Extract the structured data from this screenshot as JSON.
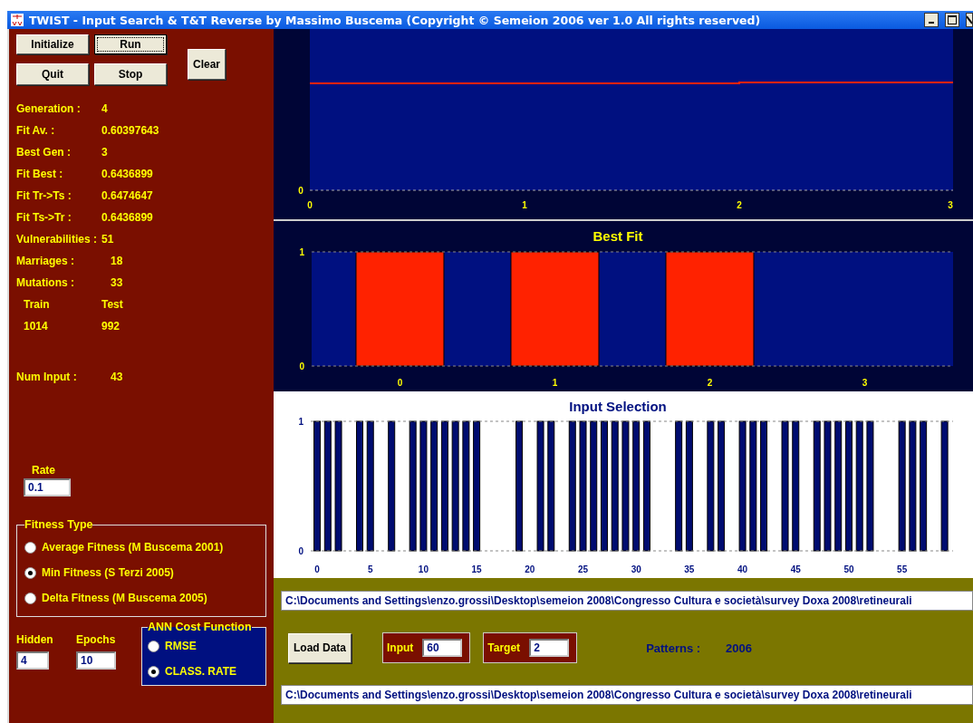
{
  "window": {
    "title": "TWIST - Input Search & T&T Reverse  by Massimo Buscema (Copyright © Semeion 2006 ver 1.0  All rights reserved)"
  },
  "buttons": [
    {
      "label": "Initialize",
      "focused": false
    },
    {
      "label": "Run",
      "focused": true
    },
    {
      "label": "Quit",
      "focused": false
    },
    {
      "label": "Stop",
      "focused": false
    },
    {
      "label": "Clear",
      "focused": false
    }
  ],
  "stats": [
    {
      "label": "Generation :",
      "value": "4"
    },
    {
      "label": "Fit Av. :",
      "value": "0.60397643"
    },
    {
      "label": "Best Gen :",
      "value": "3"
    },
    {
      "label": "Fit Best :",
      "value": "0.6436899"
    },
    {
      "label": "Fit Tr->Ts :",
      "value": "0.6474647"
    },
    {
      "label": "Fit Ts->Tr :",
      "value": "0.6436899"
    },
    {
      "label": "Vulnerabilities :",
      "value": "51"
    },
    {
      "label": "Marriages :",
      "value": "18"
    },
    {
      "label": "Mutations :",
      "value": "33"
    }
  ],
  "split": {
    "train_label": "Train",
    "test_label": "Test",
    "train": "1014",
    "test": "992"
  },
  "num_input": {
    "label": "Num Input  :",
    "value": "43"
  },
  "rate": {
    "label": "Rate",
    "value": "0.1"
  },
  "fitness_type": {
    "title": "Fitness Type",
    "options": [
      {
        "label": "Average Fitness (M Buscema 2001)",
        "selected": false
      },
      {
        "label": "Min Fitness (S Terzi 2005)",
        "selected": true
      },
      {
        "label": "Delta Fitness (M Buscema 2005)",
        "selected": false
      }
    ]
  },
  "hidden": {
    "label": "Hidden",
    "value": "4"
  },
  "epochs": {
    "label": "Epochs",
    "value": "10"
  },
  "ann_cost": {
    "title": "ANN Cost Function",
    "options": [
      {
        "label": "RMSE",
        "selected": false
      },
      {
        "label": "CLASS. RATE",
        "selected": true
      }
    ]
  },
  "fitness_plot": {
    "y_labels": [
      "0"
    ],
    "x_labels": [
      "0",
      "1",
      "2",
      "3"
    ]
  },
  "best_fit": {
    "chart_data": {
      "type": "bar",
      "title": "Best Fit",
      "categories": [
        "0",
        "1",
        "2",
        "3"
      ],
      "ylim": [
        0,
        1
      ],
      "yticks": [
        0,
        1
      ],
      "series": [
        {
          "color": "#ff2200",
          "values": [
            1,
            1,
            1,
            0
          ]
        }
      ]
    }
  },
  "input_selection": {
    "chart_data": {
      "type": "bar",
      "title": "Input Selection",
      "x": [
        0,
        1,
        2,
        3,
        4,
        5,
        6,
        7,
        8,
        9,
        10,
        11,
        12,
        13,
        14,
        15,
        16,
        17,
        18,
        19,
        20,
        21,
        22,
        23,
        24,
        25,
        26,
        27,
        28,
        29,
        30,
        31,
        32,
        33,
        34,
        35,
        36,
        37,
        38,
        39,
        40,
        41,
        42,
        43,
        44,
        45,
        46,
        47,
        48,
        49,
        50,
        51,
        52,
        53,
        54,
        55,
        56,
        57,
        58,
        59
      ],
      "series": [
        {
          "color": "#000c70",
          "values": [
            1,
            1,
            1,
            0,
            1,
            1,
            0,
            1,
            0,
            1,
            1,
            1,
            1,
            1,
            1,
            1,
            0,
            0,
            0,
            1,
            0,
            1,
            1,
            0,
            1,
            1,
            1,
            1,
            1,
            1,
            1,
            1,
            0,
            0,
            1,
            1,
            0,
            1,
            1,
            0,
            1,
            1,
            1,
            0,
            1,
            1,
            0,
            1,
            1,
            1,
            1,
            1,
            1,
            0,
            0,
            1,
            1,
            1,
            0,
            1
          ]
        }
      ],
      "xlim": [
        -0.6,
        59.8
      ],
      "ylim": [
        0,
        1
      ],
      "xticks": [
        0,
        5,
        10,
        15,
        20,
        25,
        30,
        35,
        40,
        45,
        50,
        55
      ],
      "yticks": [
        0,
        1
      ]
    }
  },
  "data_path": "C:\\Documents and Settings\\enzo.grossi\\Desktop\\semeion 2008\\Congresso Cultura e società\\survey Doxa 2008\\retineurali",
  "load_button": "Load Data",
  "input_count": {
    "label": "Input",
    "value": "60"
  },
  "target_count": {
    "label": "Target",
    "value": "2"
  },
  "patterns": {
    "label": "Patterns  :",
    "value": "2006"
  },
  "output_path": "C:\\Documents and Settings\\enzo.grossi\\Desktop\\semeion 2008\\Congresso Cultura e società\\survey Doxa 2008\\retineurali"
}
